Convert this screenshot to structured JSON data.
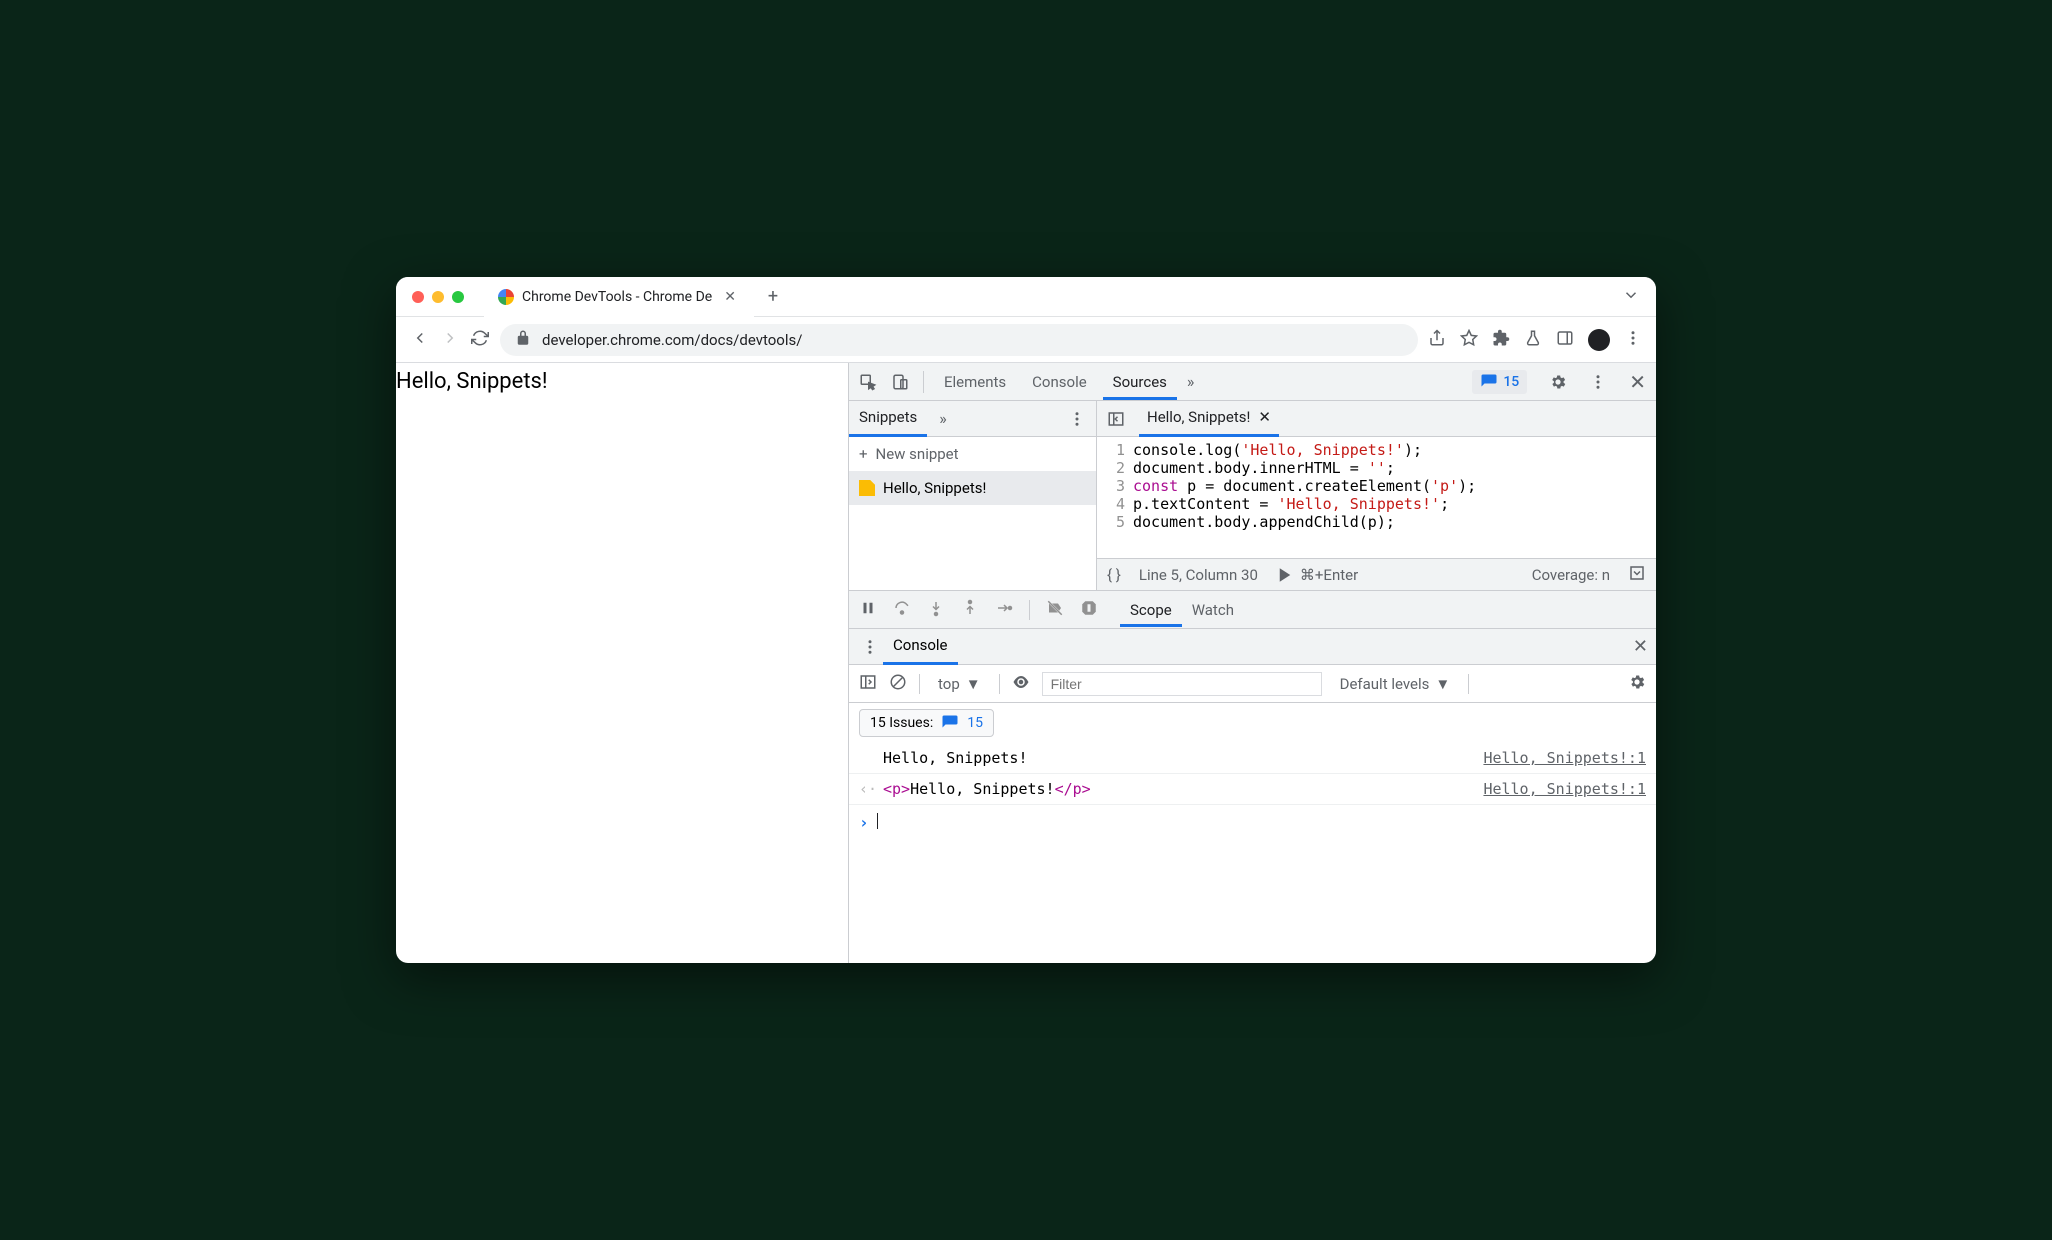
{
  "browser": {
    "tab_title": "Chrome DevTools - Chrome De",
    "url": "developer.chrome.com/docs/devtools/"
  },
  "page": {
    "body_text": "Hello, Snippets!"
  },
  "devtools": {
    "tabs": {
      "elements": "Elements",
      "console": "Console",
      "sources": "Sources"
    },
    "issues_count": "15",
    "snippets": {
      "tab_label": "Snippets",
      "new_label": "New snippet",
      "item": "Hello, Snippets!"
    },
    "editor": {
      "tab_label": "Hello, Snippets!",
      "lines": [
        {
          "n": "1",
          "pre": "console.log(",
          "str": "'Hello, Snippets!'",
          "post": ");"
        },
        {
          "n": "2",
          "pre": "document.body.innerHTML = ",
          "str": "''",
          "post": ";"
        },
        {
          "n": "3",
          "kw": "const",
          "mid": " p = document.createElement(",
          "str": "'p'",
          "post": ");"
        },
        {
          "n": "4",
          "pre": "p.textContent = ",
          "str": "'Hello, Snippets!'",
          "post": ";"
        },
        {
          "n": "5",
          "pre": "document.body.appendChild(p);",
          "str": "",
          "post": ""
        }
      ],
      "status_line": "Line 5, Column 30",
      "run_hint": "⌘+Enter",
      "coverage": "Coverage: n"
    },
    "debugger": {
      "scope": "Scope",
      "watch": "Watch"
    },
    "drawer": {
      "tab": "Console",
      "context": "top",
      "filter_placeholder": "Filter",
      "levels": "Default levels",
      "issues_label": "15 Issues:",
      "issues_count": "15",
      "logs": [
        {
          "text": "Hello, Snippets!",
          "source": "Hello, Snippets!:1"
        },
        {
          "html_open": "<p>",
          "html_text": "Hello, Snippets!",
          "html_close": "</p>",
          "source": "Hello, Snippets!:1"
        }
      ]
    }
  }
}
